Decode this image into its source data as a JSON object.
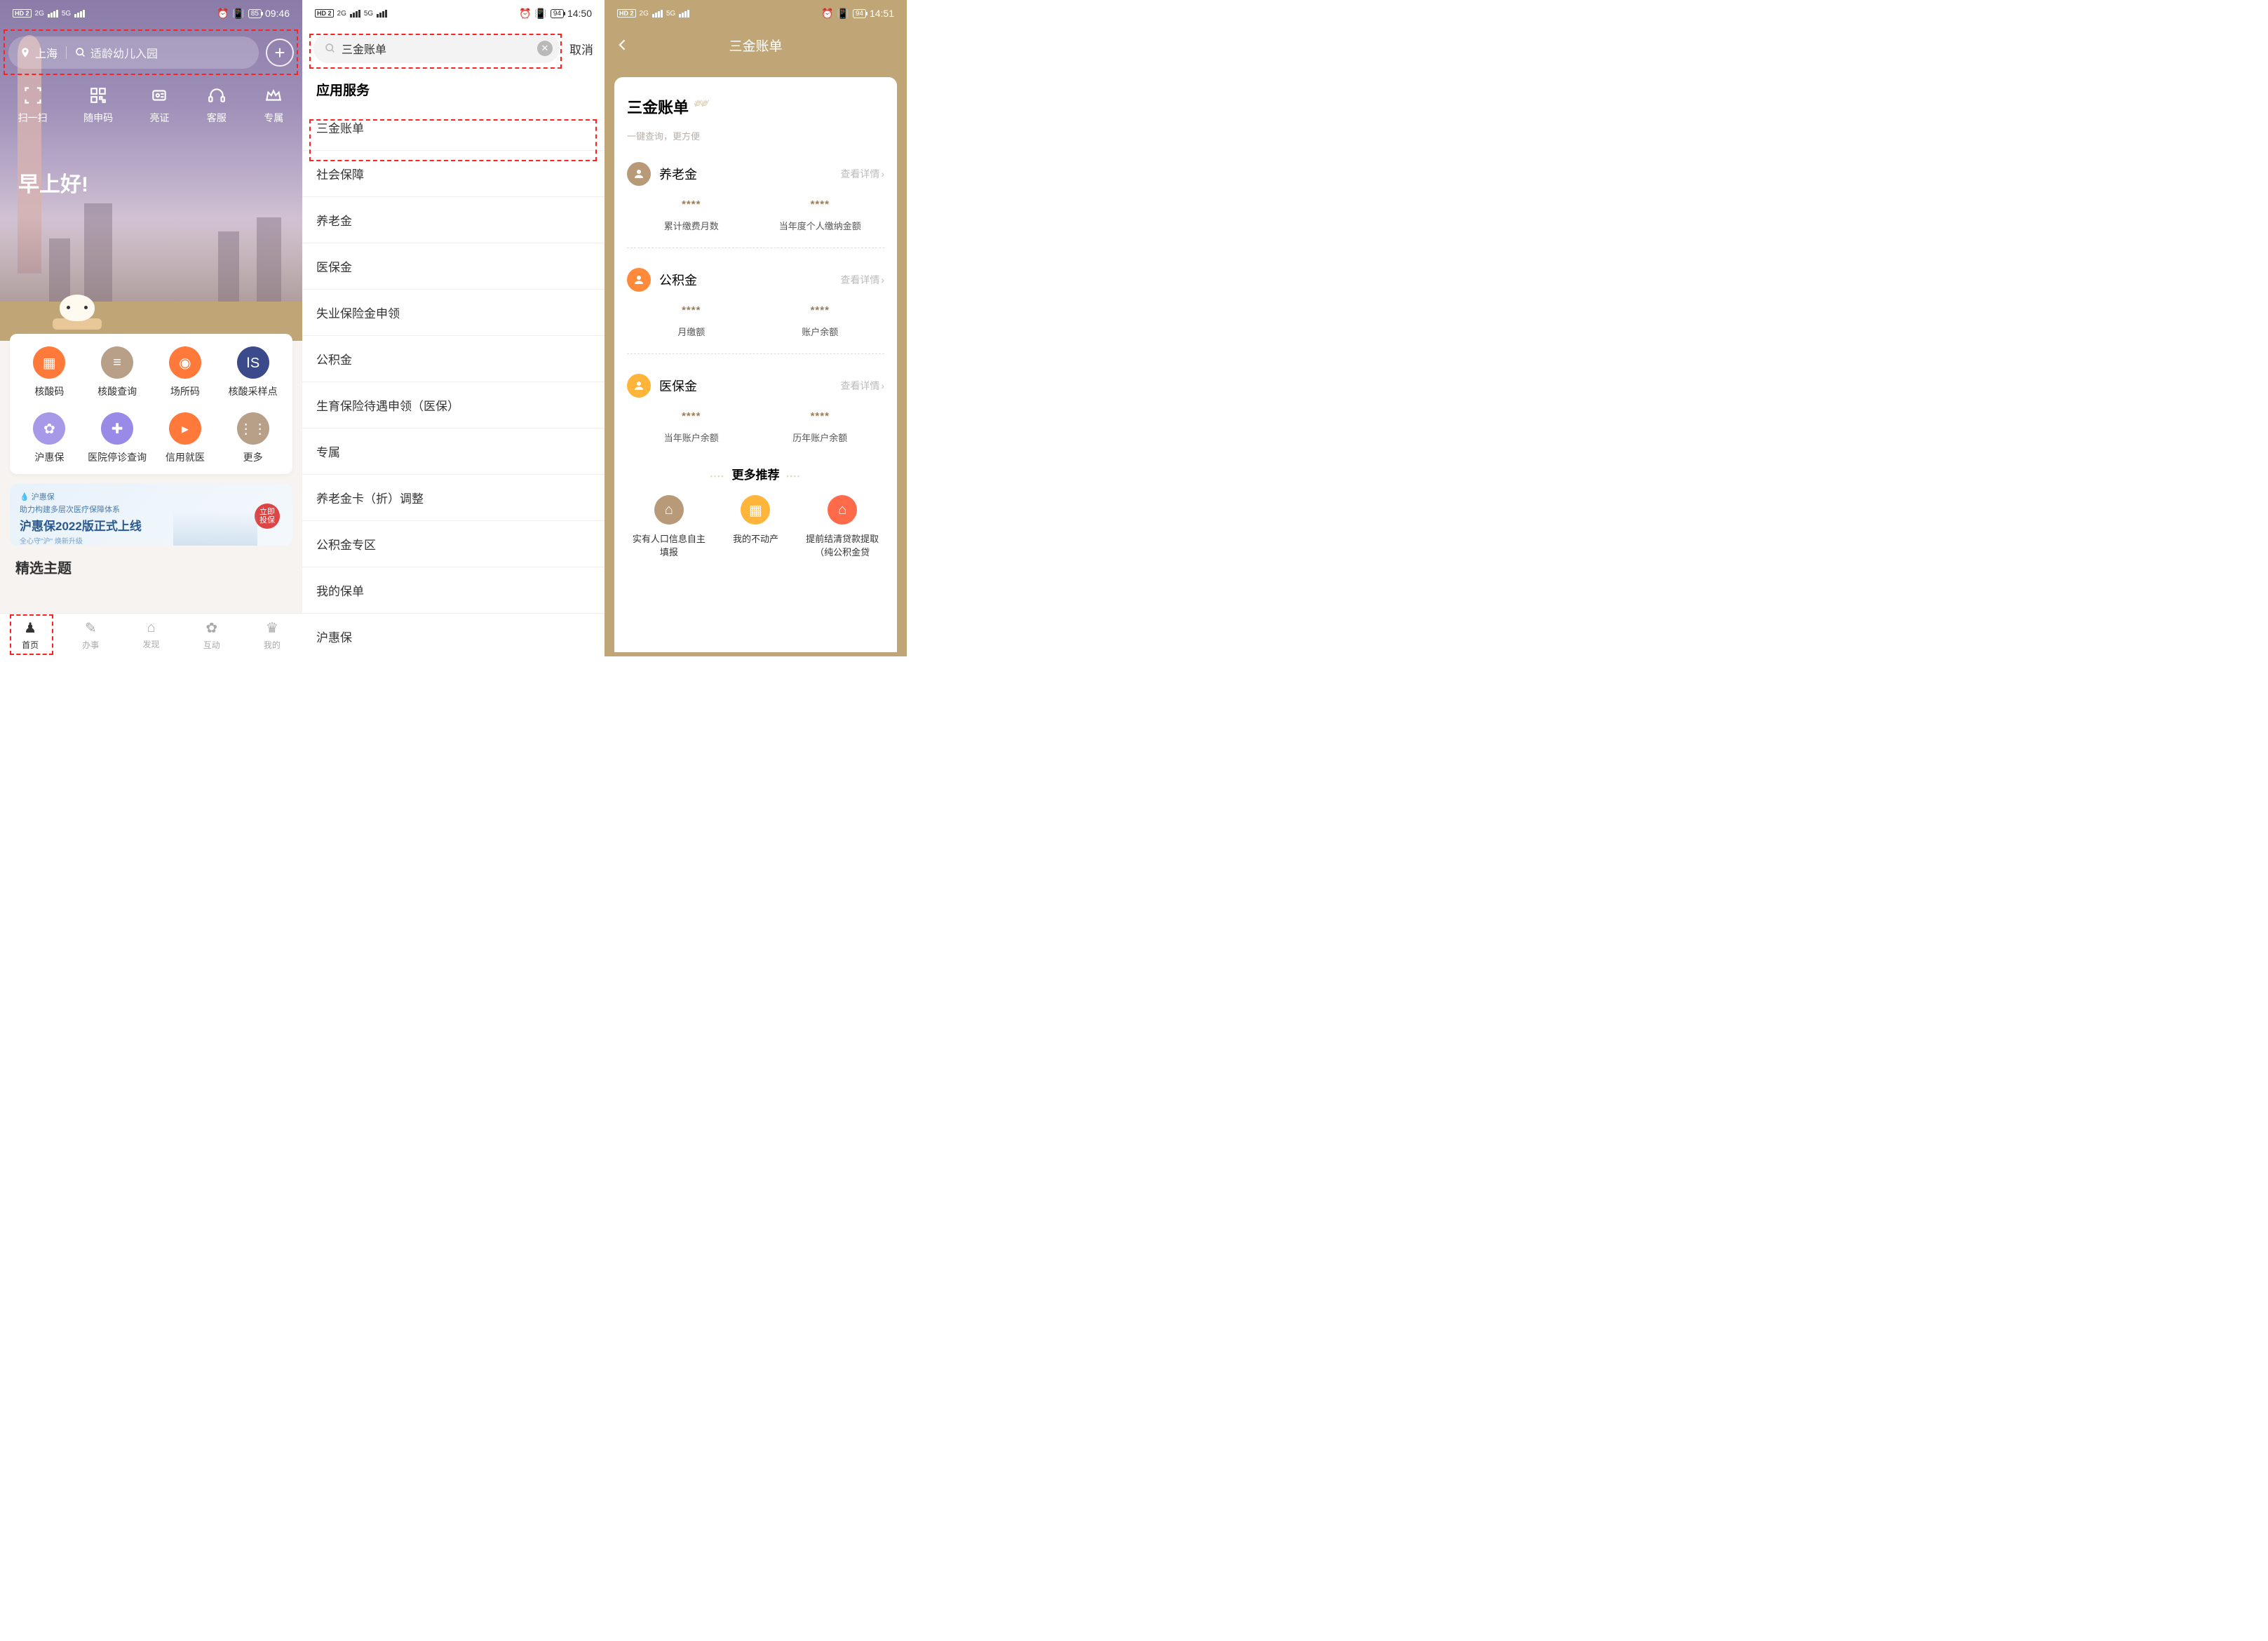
{
  "screen1": {
    "status": {
      "hd": "HD 2",
      "net1": "2G",
      "net2": "5G",
      "battery": "85",
      "time": "09:46"
    },
    "search": {
      "location": "上海",
      "placeholder": "适龄幼儿入园"
    },
    "toolbar": [
      {
        "label": "扫一扫",
        "icon": "scan"
      },
      {
        "label": "随申码",
        "icon": "qr"
      },
      {
        "label": "亮证",
        "icon": "badge"
      },
      {
        "label": "客服",
        "icon": "headset"
      },
      {
        "label": "专属",
        "icon": "crown"
      }
    ],
    "greeting": "早上好!",
    "services": [
      {
        "label": "核酸码",
        "color": "#ff7a3a",
        "icon": "qr"
      },
      {
        "label": "核酸查询",
        "color": "#b8a088",
        "icon": "doc"
      },
      {
        "label": "场所码",
        "color": "#ff7a3a",
        "icon": "pin"
      },
      {
        "label": "核酸采样点",
        "color": "#3a4a8a",
        "icon": "is"
      },
      {
        "label": "沪惠保",
        "color": "#a898e8",
        "icon": "lotus"
      },
      {
        "label": "医院停诊查询",
        "color": "#9a8ae8",
        "icon": "hospital"
      },
      {
        "label": "信用就医",
        "color": "#ff7a3a",
        "icon": "phone"
      },
      {
        "label": "更多",
        "color": "#b8a088",
        "icon": "dots"
      }
    ],
    "banner": {
      "brand": "沪惠保",
      "line1": "助力构建多层次医疗保障体系",
      "line2": "沪惠保2022版正式上线",
      "line3": "全心守\"沪\" 焕新升级",
      "cta": "立即投保"
    },
    "section_cut": "精选主题",
    "tabs": [
      {
        "label": "首页",
        "active": true
      },
      {
        "label": "办事",
        "active": false
      },
      {
        "label": "发现",
        "active": false
      },
      {
        "label": "互动",
        "active": false
      },
      {
        "label": "我的",
        "active": false
      }
    ]
  },
  "screen2": {
    "status": {
      "hd": "HD 2",
      "net1": "2G",
      "net2": "5G",
      "battery": "94",
      "time": "14:50"
    },
    "search_value": "三金账单",
    "cancel": "取消",
    "section_title": "应用服务",
    "results": [
      "三金账单",
      "社会保障",
      "养老金",
      "医保金",
      "失业保险金申领",
      "公积金",
      "生育保险待遇申领（医保）",
      "专属",
      "养老金卡（折）调整",
      "公积金专区",
      "我的保单",
      "沪惠保"
    ]
  },
  "screen3": {
    "status": {
      "hd": "HD 2",
      "net1": "2G",
      "net2": "5G",
      "battery": "94",
      "time": "14:51"
    },
    "nav_title": "三金账单",
    "page_title": "三金账单",
    "subtitle": "一键查询，更方便",
    "detail_label": "查看详情",
    "mask": "****",
    "funds": [
      {
        "name": "养老金",
        "color": "#b89a78",
        "col1": "累计缴费月数",
        "col2": "当年度个人缴纳金额"
      },
      {
        "name": "公积金",
        "color": "#ff8a3a",
        "col1": "月缴额",
        "col2": "账户余额"
      },
      {
        "name": "医保金",
        "color": "#ffb43a",
        "col1": "当年账户余额",
        "col2": "历年账户余额"
      }
    ],
    "more_title": "更多推荐",
    "recs": [
      {
        "label": "实有人口信息自主填报",
        "color": "#b89a78"
      },
      {
        "label": "我的不动产",
        "color": "#ffb43a"
      },
      {
        "label": "提前结清贷款提取（纯公积金贷",
        "color": "#ff6a4a"
      }
    ]
  }
}
